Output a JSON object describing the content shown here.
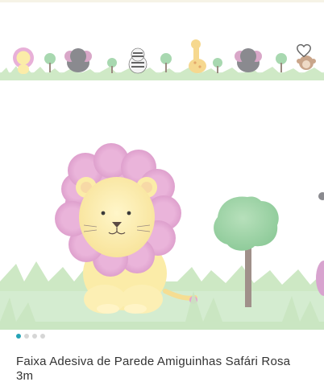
{
  "product": {
    "title": "Faixa Adesiva de Parede Amiguinhas Safári Rosa 3m"
  },
  "gallery": {
    "image_count": 4,
    "active_index": 0
  },
  "icons": {
    "favorite": "heart-outline-icon"
  },
  "colors": {
    "accent": "#26a3b6",
    "inactive_dot": "#d6d6d6",
    "lion_mane": "#e6a6d4",
    "lion_body": "#fbeca8",
    "tree": "#9ed3a8",
    "grass": "#cfe9c6"
  }
}
